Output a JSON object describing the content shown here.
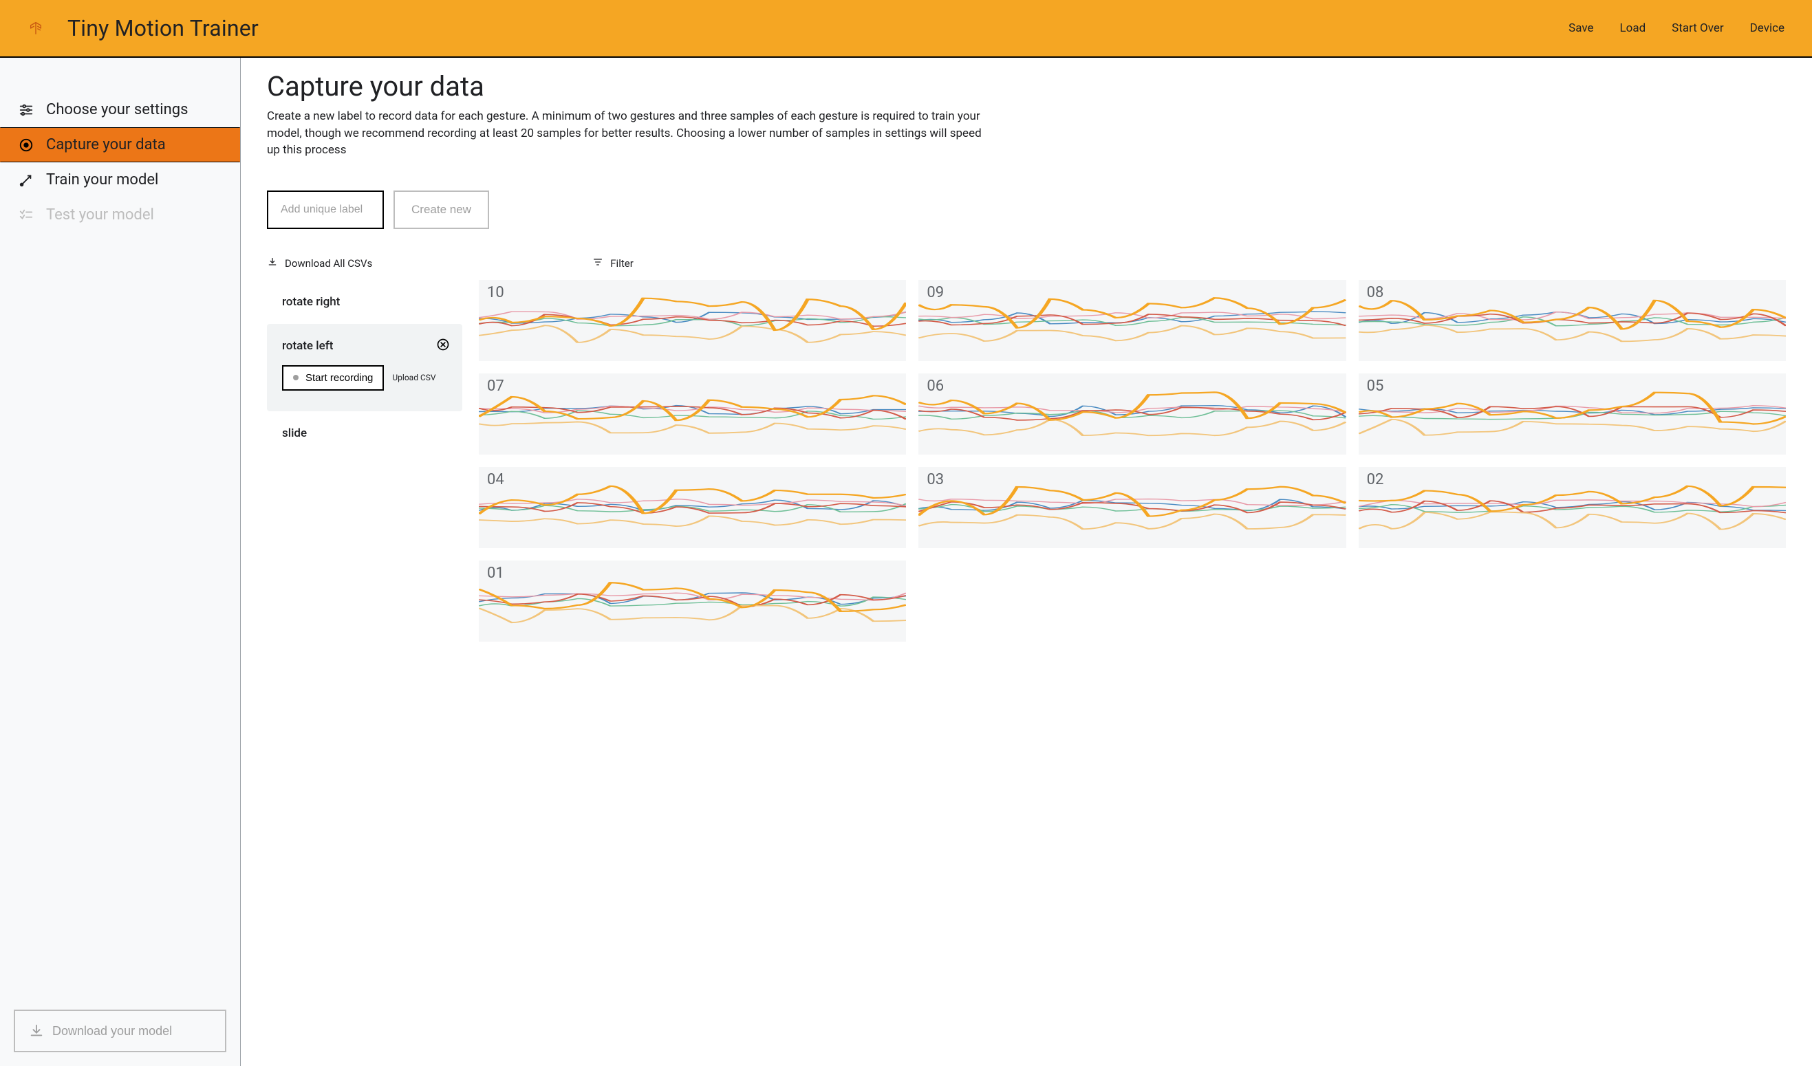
{
  "header": {
    "title": "Tiny Motion Trainer",
    "links": [
      "Save",
      "Load",
      "Start Over",
      "Device"
    ]
  },
  "sidebar": {
    "items": [
      {
        "label": "Choose your settings",
        "icon": "sliders-icon",
        "active": false,
        "disabled": false
      },
      {
        "label": "Capture your data",
        "icon": "record-icon",
        "active": true,
        "disabled": false
      },
      {
        "label": "Train your model",
        "icon": "train-icon",
        "active": false,
        "disabled": false
      },
      {
        "label": "Test your model",
        "icon": "checklist-icon",
        "active": false,
        "disabled": true
      }
    ],
    "download_model_label": "Download your model"
  },
  "main": {
    "title": "Capture your data",
    "description": "Create a new label to record data for each gesture. A minimum of two gestures and three samples of each gesture is required to train your model, though we recommend recording at least 20 samples for better results. Choosing a lower number of samples in settings will speed up this process",
    "label_input_placeholder": "Add unique label",
    "create_button": "Create new",
    "download_all": "Download All CSVs",
    "filter": "Filter"
  },
  "labels": [
    {
      "name": "rotate right",
      "selected": false
    },
    {
      "name": "rotate left",
      "selected": true,
      "start_recording_label": "Start recording",
      "upload_csv_label": "Upload CSV"
    },
    {
      "name": "slide",
      "selected": false
    }
  ],
  "samples": [
    "10",
    "09",
    "08",
    "07",
    "06",
    "05",
    "04",
    "03",
    "02",
    "01"
  ]
}
